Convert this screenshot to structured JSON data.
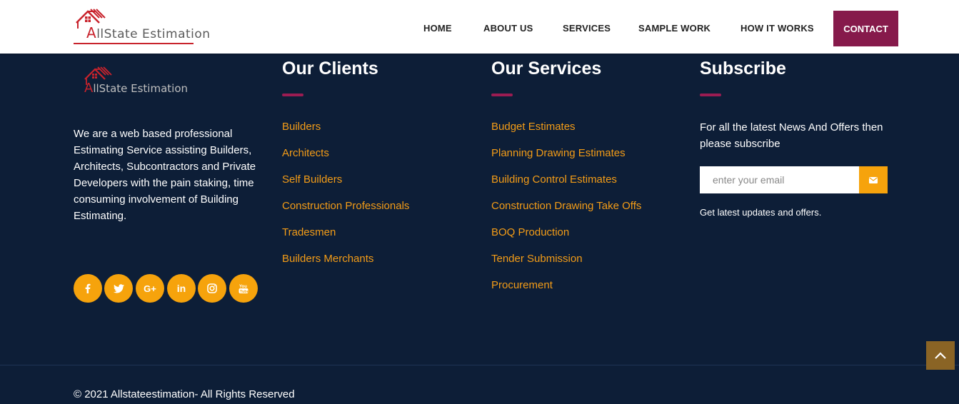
{
  "header": {
    "logo": {
      "text_prefix": "A",
      "text_rest": "llState Estimation"
    },
    "nav": [
      {
        "label": "HOME"
      },
      {
        "label": "ABOUT US"
      },
      {
        "label": "SERVICES"
      },
      {
        "label": "SAMPLE WORK"
      },
      {
        "label": "HOW IT WORKS"
      }
    ],
    "contact_label": "CONTACT"
  },
  "footer": {
    "logo": {
      "text_prefix": "A",
      "text_rest": "llState Estimation"
    },
    "about": "We are a web based professional Estimating Service assisting Builders, Architects, Subcontractors and Private Developers with the pain staking, time consuming involvement of Building Estimating.",
    "socials": [
      {
        "icon": "facebook-icon",
        "glyph": "f"
      },
      {
        "icon": "twitter-icon",
        "glyph": "🐦"
      },
      {
        "icon": "google-plus-icon",
        "glyph": "G+"
      },
      {
        "icon": "linkedin-icon",
        "glyph": "in"
      },
      {
        "icon": "instagram-icon",
        "glyph": "◎"
      },
      {
        "icon": "youtube-icon",
        "glyph": "▶"
      }
    ],
    "clients": {
      "title": "Our Clients",
      "items": [
        "Builders",
        "Architects",
        "Self Builders",
        "Construction Professionals",
        "Tradesmen",
        "Builders Merchants"
      ]
    },
    "services": {
      "title": "Our Services",
      "items": [
        "Budget Estimates",
        "Planning Drawing Estimates",
        "Building Control Estimates",
        "Construction Drawing Take Offs",
        "BOQ Production",
        "Tender Submission",
        "Procurement"
      ]
    },
    "subscribe": {
      "title": "Subscribe",
      "text": "For all the latest News And Offers then please subscribe",
      "placeholder": "enter your email",
      "note": "Get latest updates and offers."
    },
    "copyright": "© 2021 Allstateestimation- All Rights Reserved"
  },
  "colors": {
    "background": "#0d1e37",
    "accent_orange": "#f6a30c",
    "link_orange": "#f39c17",
    "contact_bg": "#861a4b",
    "bar": "#9b1c52"
  }
}
